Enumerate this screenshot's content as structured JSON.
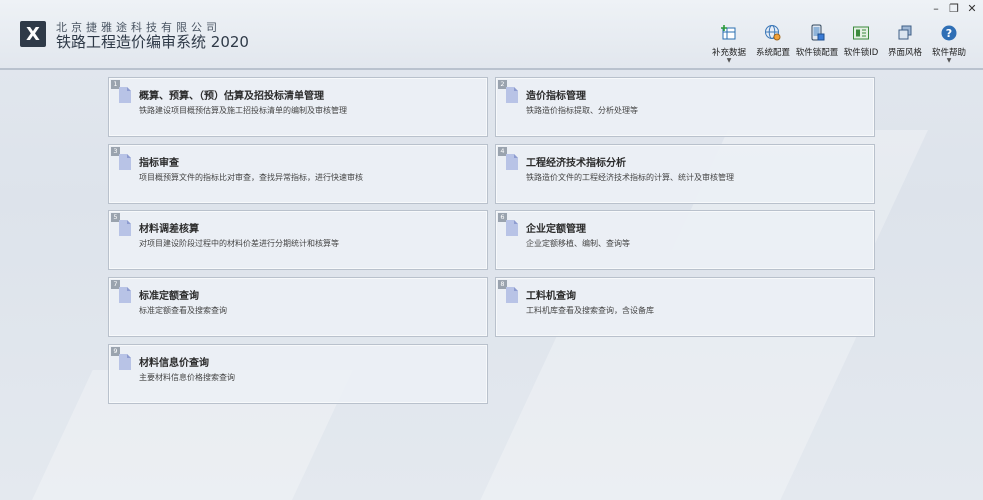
{
  "app": {
    "company": "北京捷雅途科技有限公司",
    "title": "铁路工程造价编审系统 2020",
    "logo_letter": "X"
  },
  "toolbar": [
    {
      "label": "补充数据",
      "icon": "add-data-icon",
      "has_caret": true
    },
    {
      "label": "系统配置",
      "icon": "globe-gear-icon",
      "has_caret": false
    },
    {
      "label": "软件锁配置",
      "icon": "phone-lock-icon",
      "has_caret": false
    },
    {
      "label": "软件锁ID",
      "icon": "id-card-icon",
      "has_caret": false
    },
    {
      "label": "界面风格",
      "icon": "layers-icon",
      "has_caret": false
    },
    {
      "label": "软件帮助",
      "icon": "help-icon",
      "has_caret": true
    }
  ],
  "window": {
    "minimize": "–",
    "restore": "❐",
    "close": "✕"
  },
  "modules": [
    {
      "num": "1",
      "title": "概算、预算、（预）估算及招投标清单管理",
      "desc": "铁路建设项目概预估算及施工招投标清单的编制及审核管理"
    },
    {
      "num": "2",
      "title": "造价指标管理",
      "desc": "铁路造价指标提取、分析处理等"
    },
    {
      "num": "3",
      "title": "指标审查",
      "desc": "项目概预算文件的指标比对审查，查找异常指标，进行快速审核"
    },
    {
      "num": "4",
      "title": "工程经济技术指标分析",
      "desc": "铁路造价文件的工程经济技术指标的计算、统计及审核管理"
    },
    {
      "num": "5",
      "title": "材料调差核算",
      "desc": "对项目建设阶段过程中的材料价差进行分期统计和核算等"
    },
    {
      "num": "6",
      "title": "企业定额管理",
      "desc": "企业定额移植、编制、查询等"
    },
    {
      "num": "7",
      "title": "标准定额查询",
      "desc": "标准定额查看及搜索查询"
    },
    {
      "num": "8",
      "title": "工料机查询",
      "desc": "工料机库查看及搜索查询，含设备库"
    },
    {
      "num": "9",
      "title": "材料信息价查询",
      "desc": "主要材料信息价格搜索查询"
    }
  ]
}
